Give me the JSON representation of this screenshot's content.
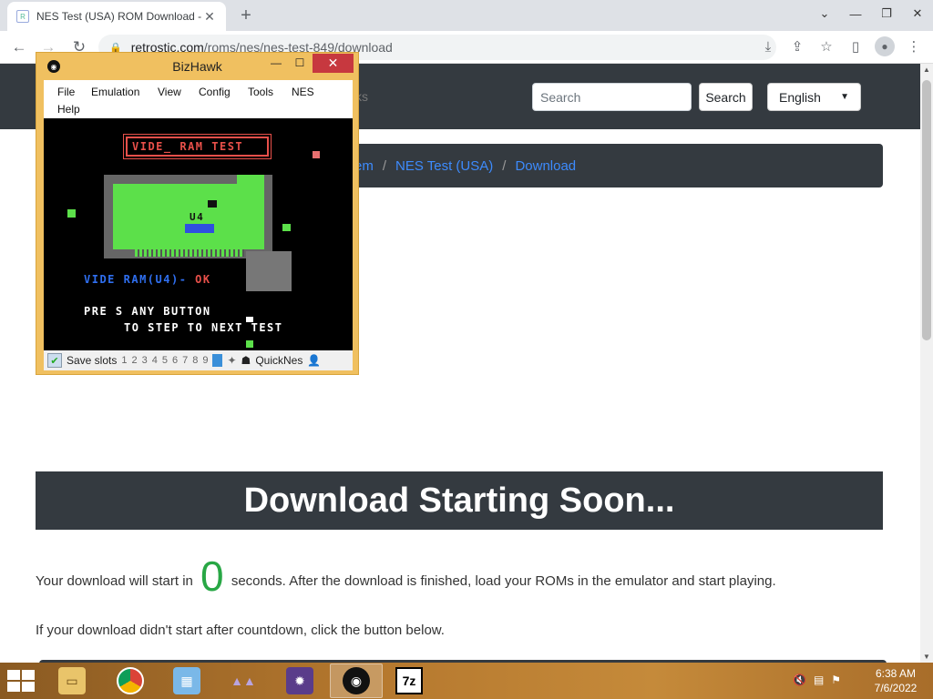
{
  "browser": {
    "tab_title": "NES Test (USA) ROM Download - ",
    "tab_close": "✕",
    "new_tab": "+",
    "url_host": "retrostic.com",
    "url_path": "/roms/nes/nes-test-849/download",
    "window_controls": [
      "⌄",
      "—",
      "❐",
      "✕"
    ]
  },
  "site": {
    "nav_partial": "ks",
    "search_placeholder": "Search",
    "search_button": "Search",
    "language": "English",
    "breadcrumb": [
      "em",
      "NES Test (USA)",
      "Download"
    ],
    "download_heading": "Download Starting Soon...",
    "countdown_prefix": "Your download will start in",
    "countdown_value": "0",
    "countdown_suffix": "seconds. After the download is finished, load your ROMs in the emulator and start playing.",
    "fallback_text": "If your download didn't start after countdown, click the button below."
  },
  "bizhawk": {
    "title": "BizHawk",
    "min": "—",
    "max": "☐",
    "close": "✕",
    "menu": [
      "File",
      "Emulation",
      "View",
      "Config",
      "Tools",
      "NES",
      "Help"
    ],
    "screen": {
      "banner": "VIDE_ RAM TEST",
      "chip_label": "U4",
      "result_left": "VIDE  RAM(U4)-",
      "result_ok": "OK",
      "prompt_line1": "PRE S ANY BUTTON",
      "prompt_line2": "TO STEP TO NEXT TEST"
    },
    "status": {
      "save_slots_label": "Save slots",
      "slots": [
        "1",
        "2",
        "3",
        "4",
        "5",
        "6",
        "7",
        "8",
        "9"
      ],
      "core": "QuickNes"
    }
  },
  "taskbar": {
    "time": "6:38 AM",
    "date": "7/6/2022",
    "sevenzip_label": "7z"
  },
  "colors": {
    "navbar": "#343a40",
    "link": "#3d8bfd",
    "countdown": "#28a745",
    "nes_green": "#5ce04a",
    "nes_blue": "#2f4fe0",
    "nes_red": "#e8504a"
  }
}
